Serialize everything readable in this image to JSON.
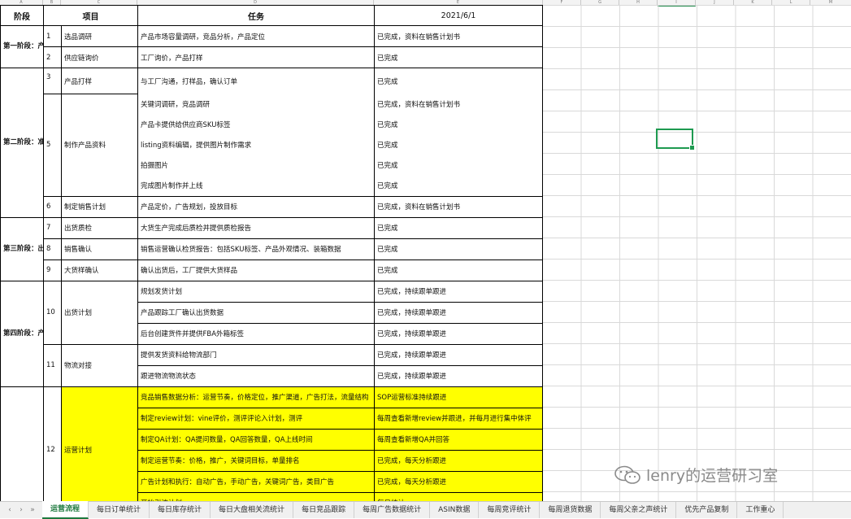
{
  "column_letters": [
    "A",
    "B",
    "C",
    "D",
    "E",
    "F",
    "G",
    "H",
    "I",
    "J",
    "K",
    "L",
    "M"
  ],
  "headers": {
    "stage": "阶段",
    "project": "项目",
    "task": "任务",
    "date": "2021/6/1"
  },
  "rows": [
    {
      "stage": "第一阶段：产品立项",
      "num": "1",
      "project": "选品调研",
      "task": "产品市场容量调研，竞品分析，产品定位",
      "status": "已完成，资料在销售计划书"
    },
    {
      "stage": "",
      "num": "2",
      "project": "供应链询价",
      "task": "工厂询价，产品打样",
      "status": "已完成"
    },
    {
      "stage": "第二阶段：准备产品资料",
      "num": "3",
      "project": "产品打样",
      "task": "与工厂沟通，打样品，确认订单",
      "status": "已完成"
    },
    {
      "stage": "",
      "num": "",
      "project": "",
      "task": "关键词调研，竞品调研",
      "status": "已完成，资料在销售计划书"
    },
    {
      "stage": "",
      "num": "",
      "project": "",
      "task": "产品卡提供给供应商SKU标签",
      "status": "已完成"
    },
    {
      "stage": "",
      "num": "5",
      "project": "制作产品资料",
      "task": "listing资料编辑，提供图片制作需求",
      "status": "已完成"
    },
    {
      "stage": "",
      "num": "",
      "project": "",
      "task": "拍摄图片",
      "status": "已完成"
    },
    {
      "stage": "",
      "num": "",
      "project": "",
      "task": "完成图片制作并上线",
      "status": "已完成"
    },
    {
      "stage": "",
      "num": "6",
      "project": "制定销售计划",
      "task": "产品定价，广告规划，投放目标",
      "status": "已完成，资料在销售计划书"
    },
    {
      "stage": "第三阶段：出货前准备",
      "num": "7",
      "project": "出货质检",
      "task": "大货生产完成后质检并提供质检报告",
      "status": "已完成"
    },
    {
      "stage": "",
      "num": "8",
      "project": "销售确认",
      "task": "销售运营确认检货报告：包括SKU标签、产品外观情况、装箱数据",
      "status": "已完成"
    },
    {
      "stage": "",
      "num": "9",
      "project": "大货样确认",
      "task": "确认出货后，工厂提供大货样品",
      "status": "已完成"
    },
    {
      "stage": "第四阶段：产品发货",
      "num": "10",
      "project": "出货计划",
      "task": "规划发货计划",
      "status": "已完成，持续跟单跟进"
    },
    {
      "stage": "",
      "num": "",
      "project": "",
      "task": "产品跟踪工厂确认出货数据",
      "status": "已完成，持续跟单跟进"
    },
    {
      "stage": "",
      "num": "",
      "project": "",
      "task": "后台创建货件并提供FBA外箱标签",
      "status": "已完成，持续跟单跟进"
    },
    {
      "stage": "",
      "num": "11",
      "project": "物流对接",
      "task": "提供发货资料给物流部门",
      "status": "已完成，持续跟单跟进"
    },
    {
      "stage": "",
      "num": "",
      "project": "",
      "task": "跟进物流物流状态",
      "status": "已完成，持续跟单跟进"
    },
    {
      "stage": "",
      "num": "12",
      "project": "运营计划",
      "task": "竞品销售数据分析：运营节奏，价格定位，推广渠道，广告打法，流量结构",
      "status": "SOP运营标准持续跟进"
    },
    {
      "stage": "",
      "num": "",
      "project": "",
      "task": "制定review计划：vine评价，测评评论入计划，测评",
      "status": "每周查看新增review并跟进，并每月进行集中体评"
    },
    {
      "stage": "",
      "num": "",
      "project": "",
      "task": "制定QA计划：QA提问数量，QA回答数量，QA上线时间",
      "status": "每周查看新增QA并回答"
    },
    {
      "stage": "",
      "num": "",
      "project": "",
      "task": "制定运营节奏：价格，推广，关键词目标，单量排名",
      "status": "已完成，每天分析跟进"
    },
    {
      "stage": "",
      "num": "",
      "project": "",
      "task": "广告计划和执行：自动广告，手动广告，关键词广告，类目广告",
      "status": "已完成，每天分析跟进"
    },
    {
      "stage": "",
      "num": "",
      "project": "",
      "task": "开始引流计划",
      "status": "每日统计"
    }
  ],
  "tabs": [
    "运营流程",
    "每日订单统计",
    "每日库存统计",
    "每日大盘相关流统计",
    "每日竞品跟踪",
    "每周广告数据统计",
    "ASIN数据",
    "每周竞评统计",
    "每周退货数据",
    "每周父亲之声统计",
    "优先产品复制",
    "工作重心"
  ],
  "active_tab": "运营流程",
  "watermark": "lenry的运营研习室",
  "colors": {
    "highlight": "#ffff00",
    "selection": "#1e9a50",
    "active_tab": "#1e7a3e"
  }
}
